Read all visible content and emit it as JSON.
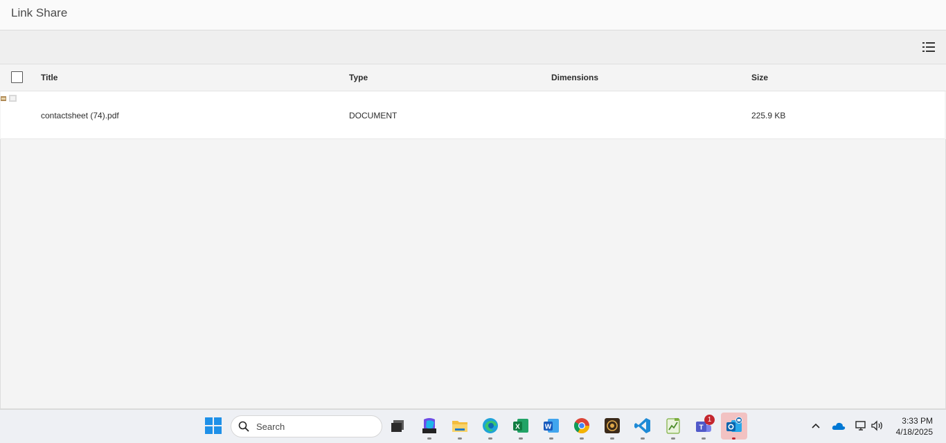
{
  "window": {
    "title": "Link Share"
  },
  "toolbar": {
    "view_icon": "list-view-icon"
  },
  "table": {
    "columns": [
      "Title",
      "Type",
      "Dimensions",
      "Size"
    ],
    "rows": [
      {
        "title": "contactsheet (74).pdf",
        "type": "DOCUMENT",
        "dimensions": "",
        "size": "225.9 KB"
      }
    ]
  },
  "taskbar": {
    "search_placeholder": "Search",
    "pinned": [
      "start-icon",
      "task-view-icon",
      "m365-copilot-icon",
      "file-explorer-icon",
      "edge-icon",
      "excel-icon",
      "word-icon",
      "chrome-icon",
      "app-icon",
      "vscode-icon",
      "notepad-icon",
      "teams-icon",
      "outlook-icon"
    ],
    "teams_badge": "1",
    "clock": {
      "time": "3:33 PM",
      "date": "4/18/2025"
    }
  },
  "colors": {
    "accent": "#0078d4",
    "badge": "#c4262e"
  }
}
